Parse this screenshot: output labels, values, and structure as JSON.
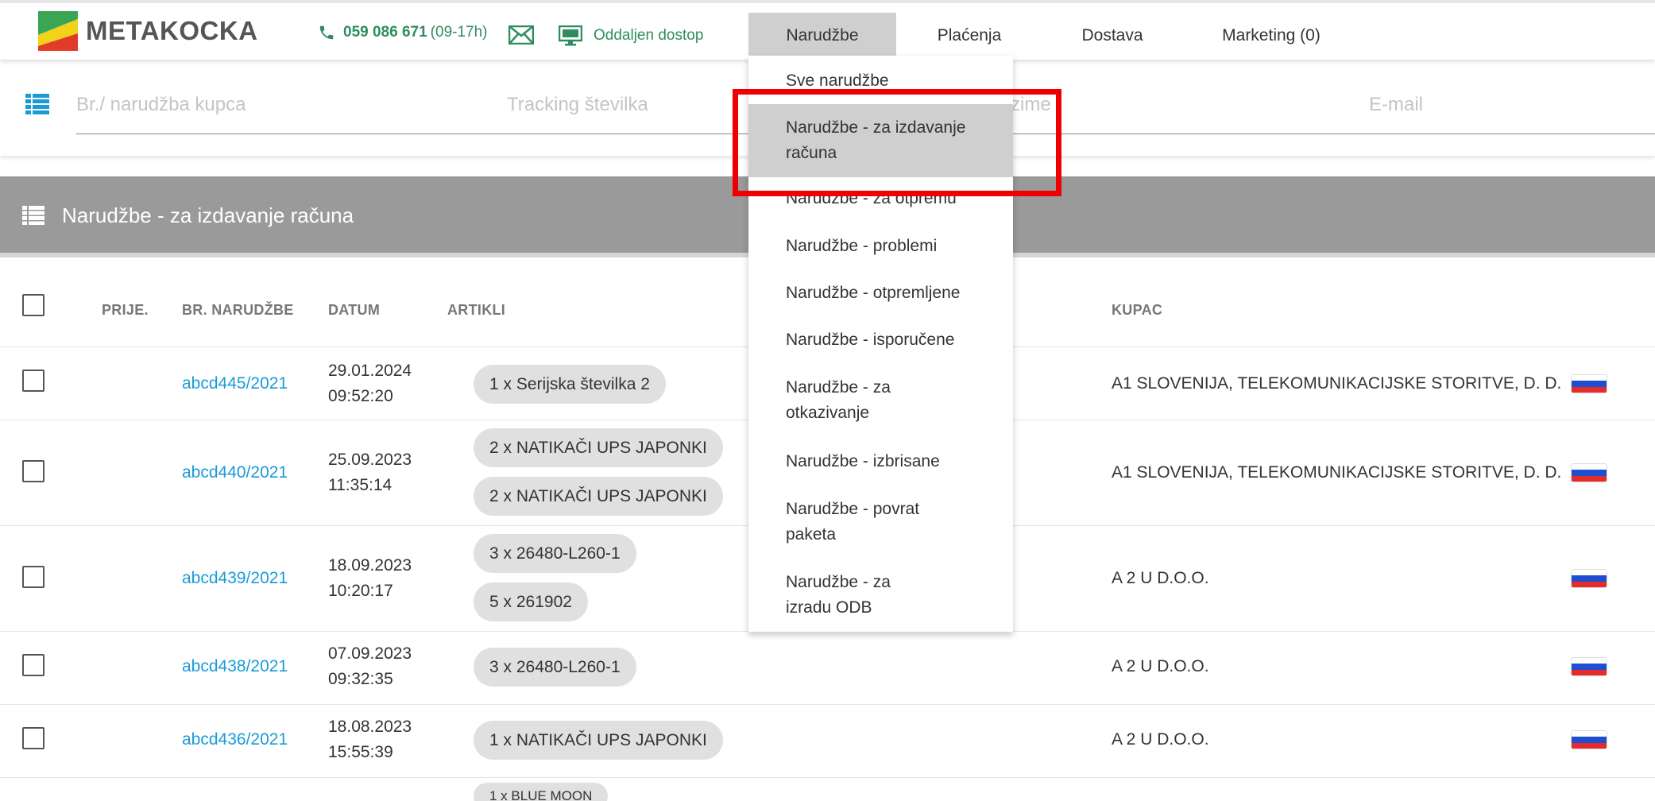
{
  "header": {
    "logo_text": "METAKOCKA",
    "phone": "059 086 671",
    "phone_hours": "(09-17h)",
    "remote_label": "Oddaljen dostop",
    "nav": [
      "Narudžbe",
      "Plaćenja",
      "Dostava",
      "Marketing (0)"
    ]
  },
  "search": {
    "placeholders": [
      "Br./ narudžba kupca",
      "Tracking številka",
      "zime",
      "E-mail"
    ]
  },
  "section": {
    "title": "Narudžbe - za izdavanje računa"
  },
  "table": {
    "headers": [
      "PRIJE.",
      "BR. NARUDŽBE",
      "DATUM",
      "ARTIKLI",
      "KUPAC"
    ],
    "rows": [
      {
        "order": "abcd445/2021",
        "date": "29.01.2024",
        "time": "09:52:20",
        "items": [
          "1 x Serijska številka 2"
        ],
        "customer": "A1 SLOVENIJA, TELEKOMUNIKACIJSKE STORITVE, D. D."
      },
      {
        "order": "abcd440/2021",
        "date": "25.09.2023",
        "time": "11:35:14",
        "items": [
          "2 x NATIKAČI UPS JAPONKI",
          "2 x NATIKAČI UPS JAPONKI"
        ],
        "customer": "A1 SLOVENIJA, TELEKOMUNIKACIJSKE STORITVE, D. D."
      },
      {
        "order": "abcd439/2021",
        "date": "18.09.2023",
        "time": "10:20:17",
        "items": [
          "3 x 26480-L260-1",
          "5 x 261902"
        ],
        "customer": "A 2 U D.O.O."
      },
      {
        "order": "abcd438/2021",
        "date": "07.09.2023",
        "time": "09:32:35",
        "items": [
          "3 x 26480-L260-1"
        ],
        "customer": "A 2 U D.O.O."
      },
      {
        "order": "abcd436/2021",
        "date": "18.08.2023",
        "time": "15:55:39",
        "items": [
          "1 x NATIKAČI UPS JAPONKI"
        ],
        "customer": "A 2 U D.O.O."
      },
      {
        "order": "",
        "date": "",
        "time": "",
        "items": [
          "1 x BLUE MOON"
        ],
        "customer": ""
      }
    ]
  },
  "dropdown": {
    "items": [
      "Sve narudžbe",
      "Narudžbe - za izdavanje računa",
      "Narudžbe - za otpremu",
      "Narudžbe - problemi",
      "Narudžbe - otpremljene",
      "Narudžbe - isporučene",
      "Narudžbe - za otkazivanje",
      "Narudžbe - izbrisane",
      "Narudžbe - povrat paketa",
      "Narudžbe - za izradu ODB"
    ]
  },
  "colors": {
    "link": "#1a9bd7",
    "accent_green": "#2f8c5f",
    "highlight_red": "#ee0000"
  }
}
